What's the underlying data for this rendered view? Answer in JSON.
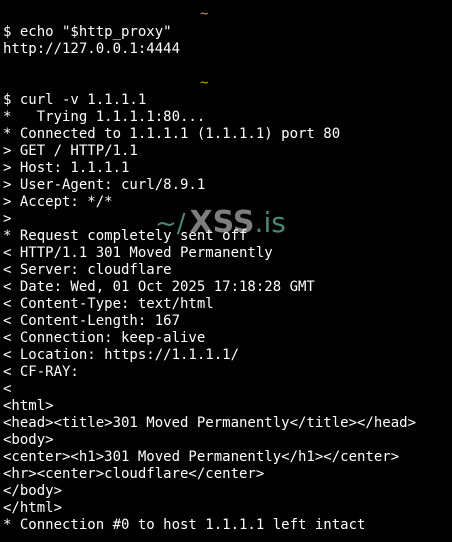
{
  "prompt_marker": "~",
  "watermark": {
    "mark": "~/",
    "brand": "XSS",
    "suffix": ".is"
  },
  "lines": [
    "$ echo \"$http_proxy\"",
    "http://127.0.0.1:4444",
    "$ curl -v 1.1.1.1",
    "*   Trying 1.1.1.1:80...",
    "* Connected to 1.1.1.1 (1.1.1.1) port 80",
    "> GET / HTTP/1.1",
    "> Host: 1.1.1.1",
    "> User-Agent: curl/8.9.1",
    "> Accept: */*",
    ">",
    "* Request completely sent off",
    "< HTTP/1.1 301 Moved Permanently",
    "< Server: cloudflare",
    "< Date: Wed, 01 Oct 2025 17:18:28 GMT",
    "< Content-Type: text/html",
    "< Content-Length: 167",
    "< Connection: keep-alive",
    "< Location: https://1.1.1.1/",
    "< CF-RAY:",
    "<",
    "<html>",
    "<head><title>301 Moved Permanently</title></head>",
    "<body>",
    "<center><h1>301 Moved Permanently</h1></center>",
    "<hr><center>cloudflare</center>",
    "</body>",
    "</html>",
    "* Connection #0 to host 1.1.1.1 left intact"
  ]
}
